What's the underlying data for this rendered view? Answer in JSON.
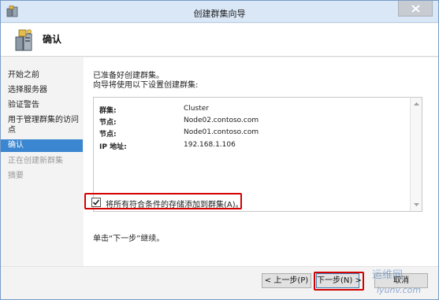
{
  "window": {
    "title": "创建群集向导",
    "close_icon": "close-icon"
  },
  "header": {
    "title": "确认",
    "icon": "cluster-icon"
  },
  "nav": {
    "items": [
      {
        "label": "开始之前",
        "state": "normal"
      },
      {
        "label": "选择服务器",
        "state": "normal"
      },
      {
        "label": "验证警告",
        "state": "normal"
      },
      {
        "label": "用于管理群集的访问",
        "state": "normal"
      },
      {
        "label": "点",
        "state": "normal"
      },
      {
        "label": "确认",
        "state": "active"
      },
      {
        "label": "正在创建新群集",
        "state": "disabled"
      },
      {
        "label": "摘要",
        "state": "disabled"
      }
    ]
  },
  "content": {
    "intro_line1": "已准备好创建群集。",
    "intro_line2": "向导将使用以下设置创建群集:",
    "summary": [
      {
        "key": "群集:",
        "value": "Cluster"
      },
      {
        "key": "节点:",
        "value": "Node02.contoso.com"
      },
      {
        "key": "节点:",
        "value": "Node01.contoso.com"
      },
      {
        "key": "IP 地址:",
        "value": "192.168.1.106"
      }
    ],
    "checkbox": {
      "label": "将所有符合条件的存储添加到群集(A)。",
      "checked": true
    },
    "footnote": "单击“下一步”继续。"
  },
  "buttons": {
    "prev": "< 上一步(P)",
    "next": "下一步(N) >",
    "cancel": "取消"
  },
  "watermark": {
    "line1": "运维网",
    "line2": "iyunv.com"
  },
  "colors": {
    "accent": "#3a86d0",
    "highlight_outline": "#d40000"
  }
}
